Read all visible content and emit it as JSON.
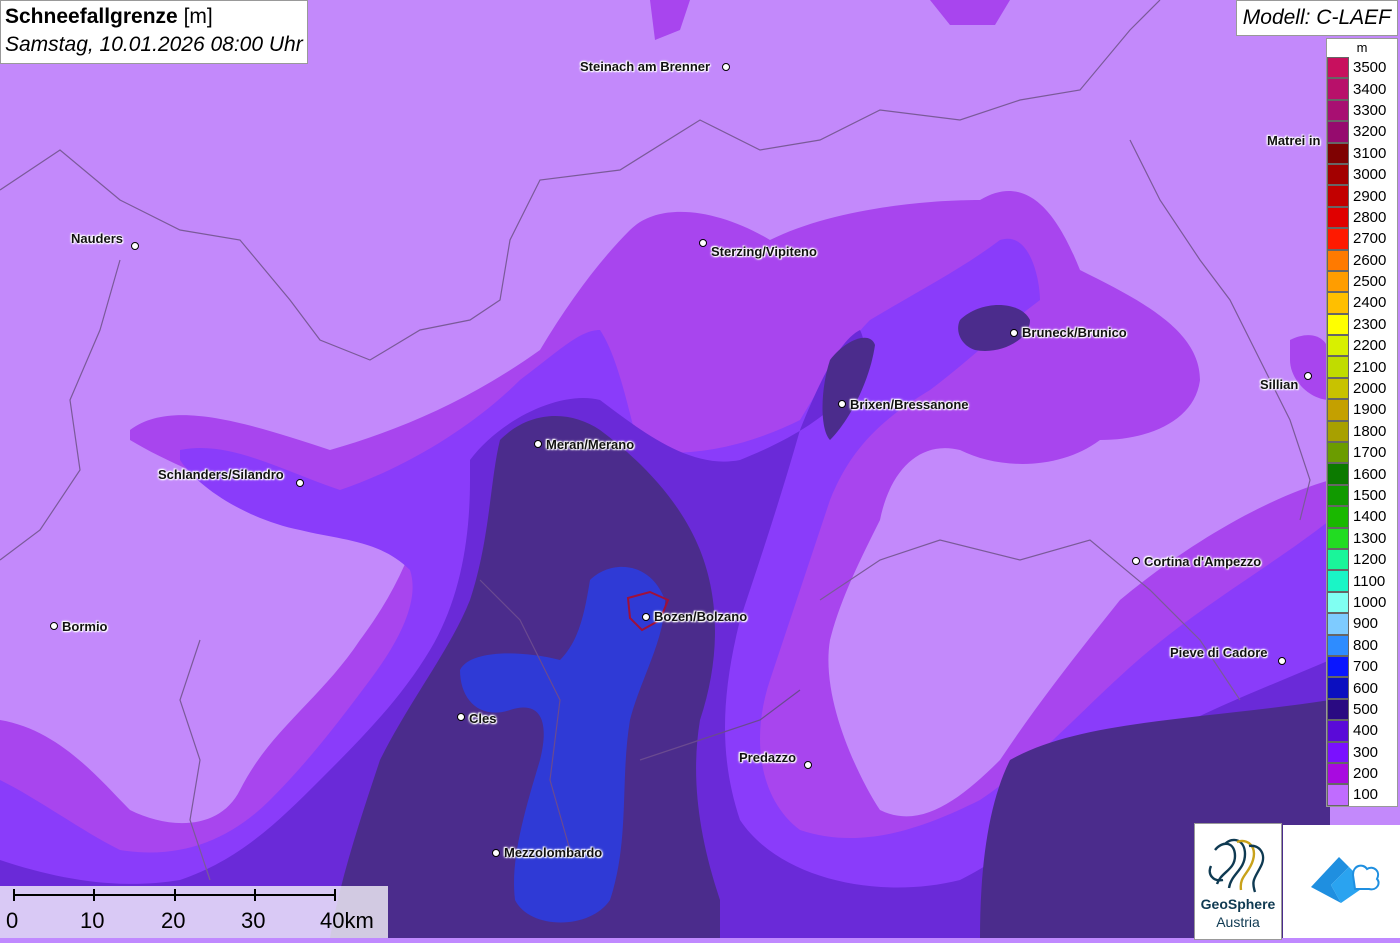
{
  "title": {
    "main": "Schneefallgrenze",
    "unit": "[m]",
    "subtitle": "Samstag, 10.01.2026 08:00 Uhr"
  },
  "model": "Modell: C-LAEF",
  "legend": {
    "unit": "m",
    "entries": [
      {
        "label": "3500",
        "color": "#c8105e"
      },
      {
        "label": "3400",
        "color": "#b8106a"
      },
      {
        "label": "3300",
        "color": "#a80f72"
      },
      {
        "label": "3200",
        "color": "#960b6e"
      },
      {
        "label": "3100",
        "color": "#7f0202"
      },
      {
        "label": "3000",
        "color": "#a30000"
      },
      {
        "label": "2900",
        "color": "#c20000"
      },
      {
        "label": "2800",
        "color": "#e00000"
      },
      {
        "label": "2700",
        "color": "#ff1a00"
      },
      {
        "label": "2600",
        "color": "#ff7a00"
      },
      {
        "label": "2500",
        "color": "#ff9d00"
      },
      {
        "label": "2400",
        "color": "#ffbf00"
      },
      {
        "label": "2300",
        "color": "#ffff00"
      },
      {
        "label": "2200",
        "color": "#d8f000"
      },
      {
        "label": "2100",
        "color": "#c0dc00"
      },
      {
        "label": "2000",
        "color": "#c8c200"
      },
      {
        "label": "1900",
        "color": "#c4a000"
      },
      {
        "label": "1800",
        "color": "#a8a000"
      },
      {
        "label": "1700",
        "color": "#6b9c00"
      },
      {
        "label": "1600",
        "color": "#0c7a00"
      },
      {
        "label": "1500",
        "color": "#119a00"
      },
      {
        "label": "1400",
        "color": "#1ab800"
      },
      {
        "label": "1300",
        "color": "#22dc22"
      },
      {
        "label": "1200",
        "color": "#1af59a"
      },
      {
        "label": "1100",
        "color": "#1af5c6"
      },
      {
        "label": "1000",
        "color": "#80fff2"
      },
      {
        "label": "900",
        "color": "#7ecbff"
      },
      {
        "label": "800",
        "color": "#2e8cff"
      },
      {
        "label": "700",
        "color": "#0a16ff"
      },
      {
        "label": "600",
        "color": "#0b0fc0"
      },
      {
        "label": "500",
        "color": "#2a0a82"
      },
      {
        "label": "400",
        "color": "#5a0ad8"
      },
      {
        "label": "300",
        "color": "#7a10ff"
      },
      {
        "label": "200",
        "color": "#a80ae0"
      },
      {
        "label": "100",
        "color": "#c06cff"
      }
    ]
  },
  "cities": [
    {
      "name": "Steinach am Brenner"
    },
    {
      "name": "Matrei in"
    },
    {
      "name": "Nauders"
    },
    {
      "name": "Sterzing/Vipiteno"
    },
    {
      "name": "Bruneck/Brunico"
    },
    {
      "name": "Sillian"
    },
    {
      "name": "Brixen/Bressanone"
    },
    {
      "name": "Meran/Merano"
    },
    {
      "name": "Schlanders/Silandro"
    },
    {
      "name": "Cortina d'Ampezzo"
    },
    {
      "name": "Bormio"
    },
    {
      "name": "Bozen/Bolzano"
    },
    {
      "name": "Pieve di Cadore"
    },
    {
      "name": "Cles"
    },
    {
      "name": "Predazzo"
    },
    {
      "name": "Mezzolombardo"
    }
  ],
  "scale": {
    "labels": [
      "0",
      "10",
      "20",
      "30",
      "40km"
    ]
  },
  "logos": {
    "geosphere_line1": "GeoSphere",
    "geosphere_line2": "Austria"
  },
  "colors": {
    "band_100": "#c389fb",
    "band_200": "#a646f0",
    "band_300": "#8a3cff",
    "band_400": "#6a2ad8",
    "band_500": "#4a2a8a",
    "band_600": "#2f3ad8"
  }
}
